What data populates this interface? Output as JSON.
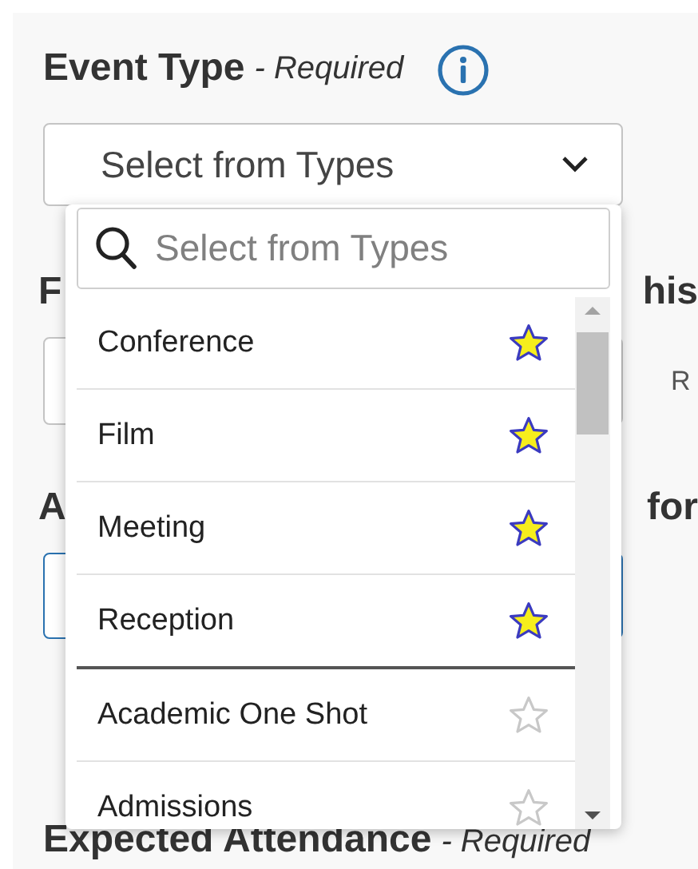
{
  "event_type": {
    "label": "Event Type",
    "note": "- Required",
    "select": {
      "value": "Select from Types",
      "expanded": true
    }
  },
  "hidden_heading_1": {
    "start": "F",
    "end": "his"
  },
  "hidden_field_1": {
    "side_text": "R"
  },
  "hidden_heading_2": {
    "start": "A",
    "end": "for"
  },
  "hidden_field_2": {
    "focused": true
  },
  "expected_attendance": {
    "label": "Expected Attendance",
    "note": "- Required"
  },
  "dropdown": {
    "search": {
      "placeholder": "Select from Types"
    },
    "items": [
      {
        "label": "Conference",
        "favorite": true
      },
      {
        "label": "Film",
        "favorite": true
      },
      {
        "label": "Meeting",
        "favorite": true
      },
      {
        "label": "Reception",
        "favorite": true
      },
      {
        "label": "Academic One Shot",
        "favorite": false
      },
      {
        "label": "Admissions",
        "favorite": false
      }
    ]
  }
}
